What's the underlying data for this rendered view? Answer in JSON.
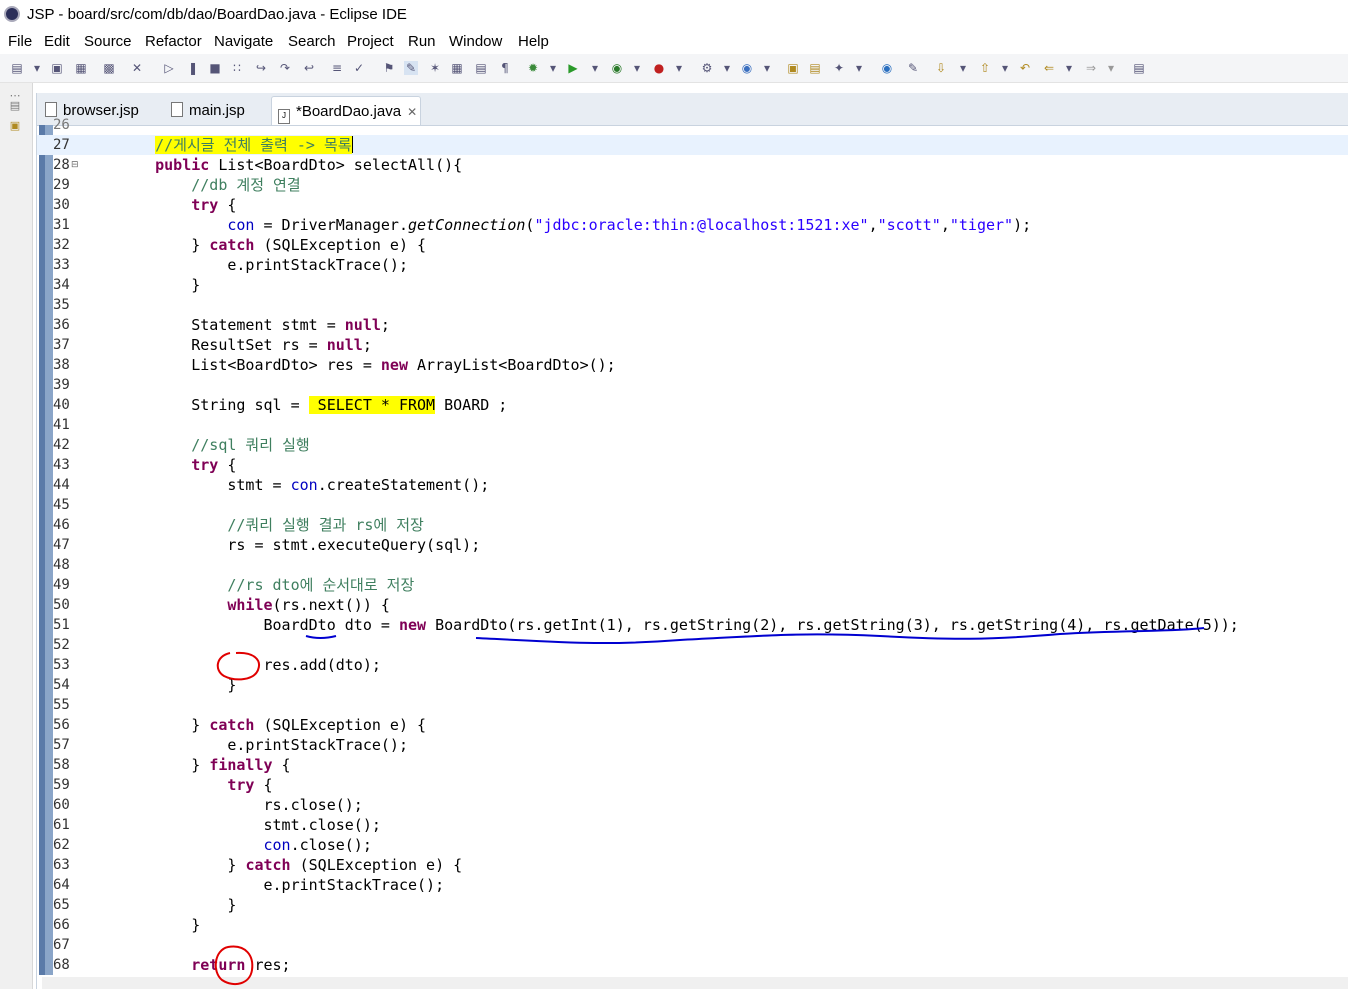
{
  "window": {
    "title": "JSP - board/src/com/db/dao/BoardDao.java - Eclipse IDE",
    "app_icon": "eclipse-icon"
  },
  "menu": [
    "File",
    "Edit",
    "Source",
    "Refactor",
    "Navigate",
    "Search",
    "Project",
    "Run",
    "Window",
    "Help"
  ],
  "tabs": [
    {
      "label": "browser.jsp",
      "icon": "jsp-file-icon"
    },
    {
      "label": "main.jsp",
      "icon": "jsp-file-icon"
    },
    {
      "label": "*BoardDao.java",
      "icon": "java-file-icon",
      "close": "✕"
    }
  ],
  "editor": {
    "partial_top_line_number": "26",
    "current_line": "27",
    "lines": [
      {
        "n": "27",
        "t": "    //게시글 전체 출력 -> 목록"
      },
      {
        "n": "28",
        "t": "    public List<BoardDto> selectAll(){"
      },
      {
        "n": "29",
        "t": "        //db 계정 연결"
      },
      {
        "n": "30",
        "t": "        try {"
      },
      {
        "n": "31",
        "t": "            con = DriverManager.getConnection(\"jdbc:oracle:thin:@localhost:1521:xe\",\"scott\",\"tiger\");"
      },
      {
        "n": "32",
        "t": "        } catch (SQLException e) {"
      },
      {
        "n": "33",
        "t": "            e.printStackTrace();"
      },
      {
        "n": "34",
        "t": "        }"
      },
      {
        "n": "35",
        "t": ""
      },
      {
        "n": "36",
        "t": "        Statement stmt = null;"
      },
      {
        "n": "37",
        "t": "        ResultSet rs = null;"
      },
      {
        "n": "38",
        "t": "        List<BoardDto> res = new ArrayList<BoardDto>();"
      },
      {
        "n": "39",
        "t": ""
      },
      {
        "n": "40",
        "t": "        String sql = \" SELECT * FROM BOARD \";"
      },
      {
        "n": "41",
        "t": ""
      },
      {
        "n": "42",
        "t": "        //sql 쿼리 실행"
      },
      {
        "n": "43",
        "t": "        try {"
      },
      {
        "n": "44",
        "t": "            stmt = con.createStatement();"
      },
      {
        "n": "45",
        "t": ""
      },
      {
        "n": "46",
        "t": "            //쿼리 실행 결과 rs에 저장"
      },
      {
        "n": "47",
        "t": "            rs = stmt.executeQuery(sql);"
      },
      {
        "n": "48",
        "t": ""
      },
      {
        "n": "49",
        "t": "            //rs dto에 순서대로 저장"
      },
      {
        "n": "50",
        "t": "            while(rs.next()) {"
      },
      {
        "n": "51",
        "t": "                BoardDto dto = new BoardDto(rs.getInt(1), rs.getString(2), rs.getString(3), rs.getString(4), rs.getDate(5));"
      },
      {
        "n": "52",
        "t": ""
      },
      {
        "n": "53",
        "t": "                res.add(dto);"
      },
      {
        "n": "54",
        "t": "            }"
      },
      {
        "n": "55",
        "t": ""
      },
      {
        "n": "56",
        "t": "        } catch (SQLException e) {"
      },
      {
        "n": "57",
        "t": "            e.printStackTrace();"
      },
      {
        "n": "58",
        "t": "        } finally {"
      },
      {
        "n": "59",
        "t": "            try {"
      },
      {
        "n": "60",
        "t": "                rs.close();"
      },
      {
        "n": "61",
        "t": "                stmt.close();"
      },
      {
        "n": "62",
        "t": "                con.close();"
      },
      {
        "n": "63",
        "t": "            } catch (SQLException e) {"
      },
      {
        "n": "64",
        "t": "                e.printStackTrace();"
      },
      {
        "n": "65",
        "t": "            }"
      },
      {
        "n": "66",
        "t": "        }"
      },
      {
        "n": "67",
        "t": ""
      },
      {
        "n": "68",
        "t": "        return res;"
      }
    ]
  },
  "colors": {
    "keyword": "#7f0055",
    "string": "#2a00ff",
    "comment": "#3f7f5f",
    "field": "#0000c0",
    "highlight": "#ffff00",
    "annotation_blue": "#0000d0",
    "annotation_red": "#e00000",
    "current_line": "#e8f2fe"
  }
}
